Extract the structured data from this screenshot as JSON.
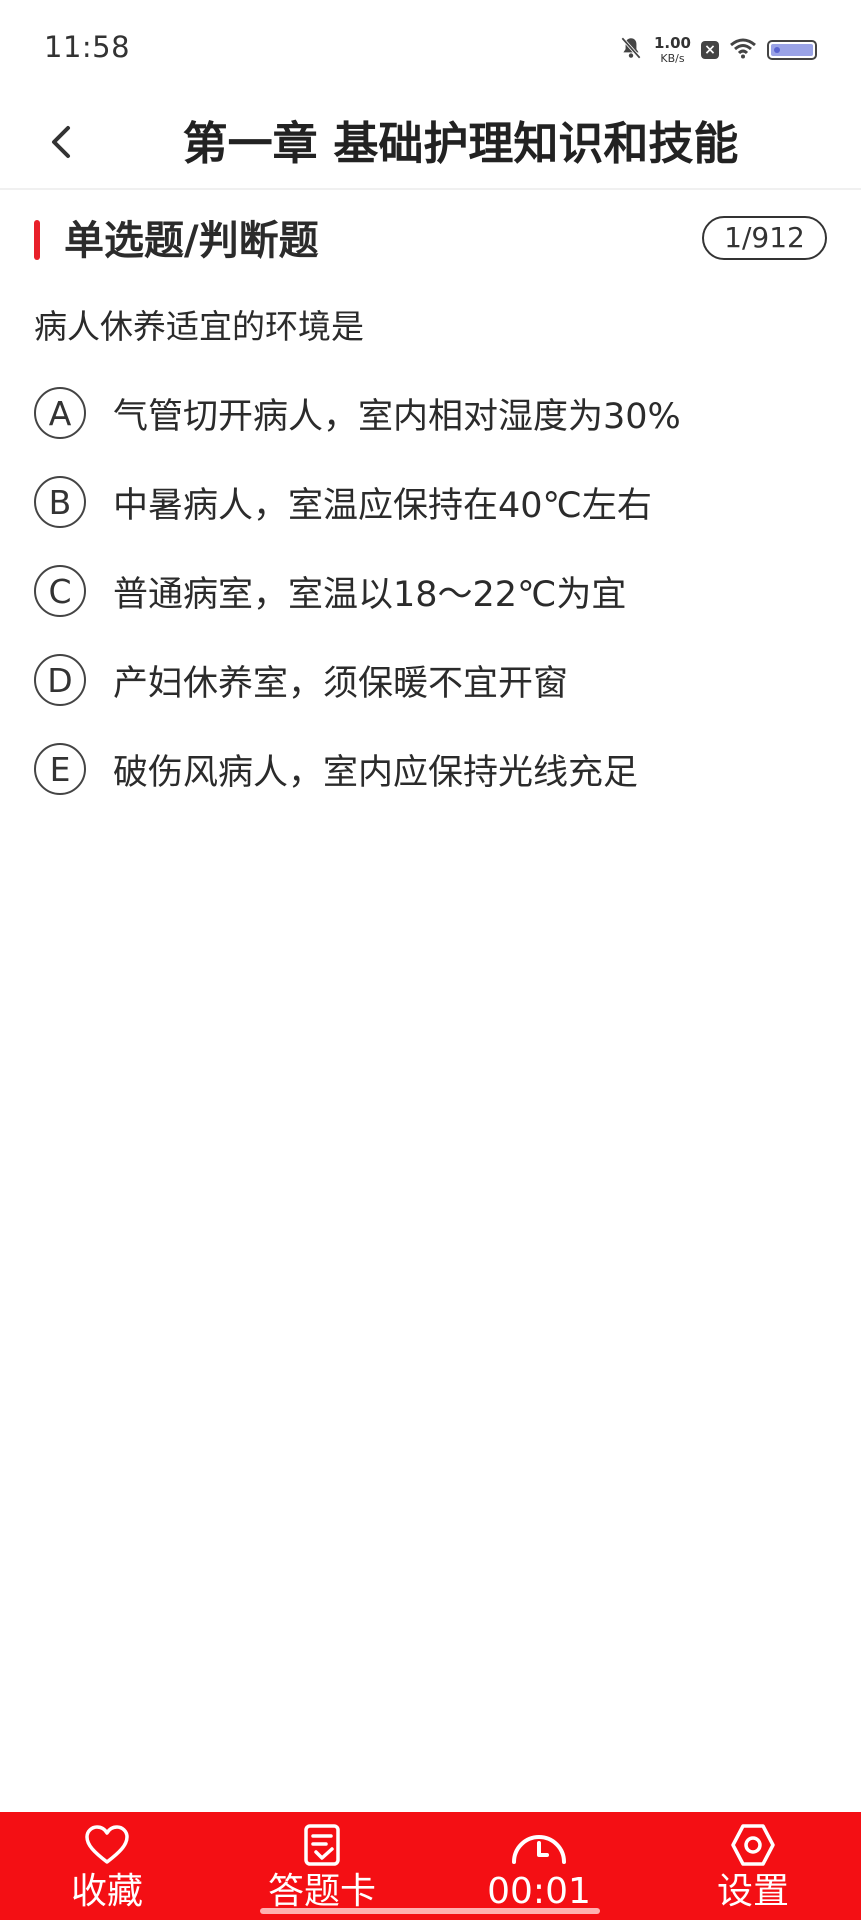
{
  "status_bar": {
    "time": "11:58",
    "net_speed_value": "1.00",
    "net_speed_unit": "KB/s",
    "icons": [
      "bell-off-icon",
      "close-box-icon",
      "wifi-icon",
      "battery-icon"
    ]
  },
  "header": {
    "title": "第一章 基础护理知识和技能",
    "back_icon": "chevron-left-icon"
  },
  "question": {
    "type_label": "单选题/判断题",
    "counter": "1/912",
    "text": "病人休养适宜的环境是",
    "options": [
      {
        "letter": "A",
        "text": "气管切开病人，室内相对湿度为30%"
      },
      {
        "letter": "B",
        "text": "中暑病人，室温应保持在40℃左右"
      },
      {
        "letter": "C",
        "text": "普通病室，室温以18～22℃为宜"
      },
      {
        "letter": "D",
        "text": "产妇休养室，须保暖不宜开窗"
      },
      {
        "letter": "E",
        "text": "破伤风病人，室内应保持光线充足"
      }
    ]
  },
  "bottom_bar": {
    "tabs": [
      {
        "label": "收藏",
        "icon": "heart-icon"
      },
      {
        "label": "答题卡",
        "icon": "answer-card-icon"
      },
      {
        "label": "00:01",
        "icon": "timer-icon"
      },
      {
        "label": "设置",
        "icon": "settings-icon"
      }
    ]
  },
  "colors": {
    "accent": "#f40f14",
    "marker": "#e8202a",
    "text": "#2b2b2b"
  }
}
